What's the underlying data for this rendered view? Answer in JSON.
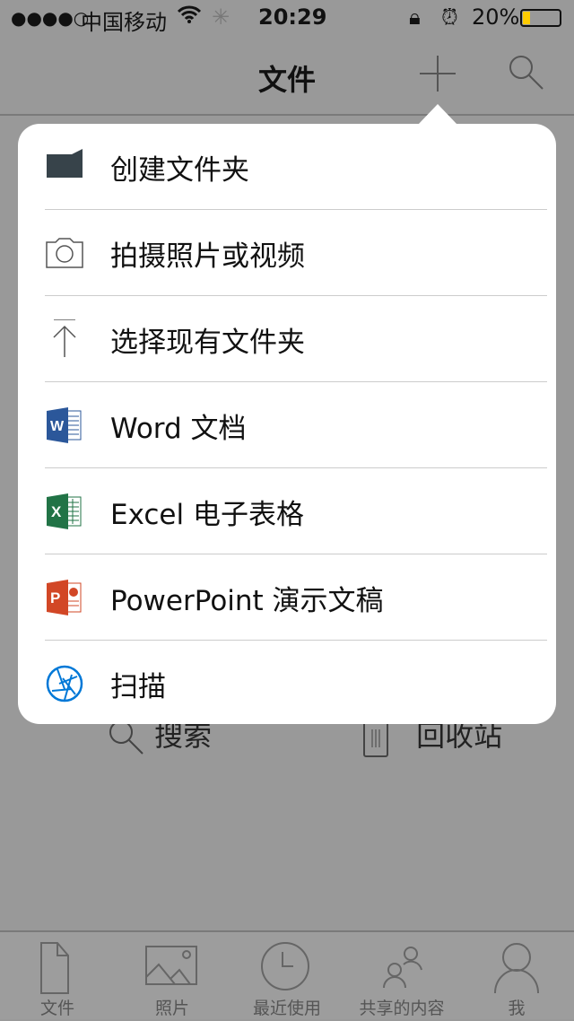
{
  "status": {
    "signal": "●●●●○",
    "carrier": "中国移动",
    "time": "20:29",
    "battery": "20%",
    "battery_level": 0.2,
    "battery_color": "#ffcc00"
  },
  "nav": {
    "title": "文件"
  },
  "menu": {
    "items": [
      {
        "label": "创建文件夹",
        "icon": "folder-icon"
      },
      {
        "label": "拍摄照片或视频",
        "icon": "camera-icon"
      },
      {
        "label": "选择现有文件夹",
        "icon": "upload-icon"
      },
      {
        "label": "Word 文档",
        "icon": "word-icon",
        "color": "#2b579a"
      },
      {
        "label": "Excel 电子表格",
        "icon": "excel-icon",
        "color": "#217346"
      },
      {
        "label": "PowerPoint 演示文稿",
        "icon": "powerpoint-icon",
        "color": "#d24726"
      },
      {
        "label": "扫描",
        "icon": "scan-icon",
        "color": "#0078d7"
      }
    ]
  },
  "background": {
    "search": "搜索",
    "recycle": "回收站"
  },
  "tabs": [
    "文件",
    "照片",
    "最近使用",
    "共享的内容",
    "我"
  ]
}
